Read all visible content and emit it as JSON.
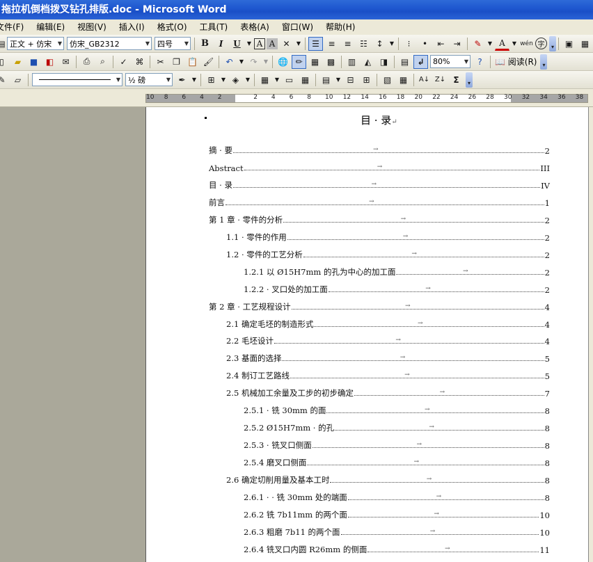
{
  "window": {
    "title": "拖拉机倒档拨叉钻孔排版.doc - Microsoft Word"
  },
  "menu": [
    "文件(F)",
    "编辑(E)",
    "视图(V)",
    "插入(I)",
    "格式(O)",
    "工具(T)",
    "表格(A)",
    "窗口(W)",
    "帮助(H)"
  ],
  "format_toolbar": {
    "style": "正文 + 仿宋",
    "font": "仿宋_GB2312",
    "size": "四号",
    "bold": "B",
    "italic": "I",
    "underline": "U",
    "char_border": "A",
    "char_shading": "A",
    "font_color": "A",
    "phonetic": "wén",
    "enclose": "字"
  },
  "standard_toolbar": {
    "zoom": "80%",
    "read_label": "阅读(R)"
  },
  "drawing_toolbar": {
    "line_weight": "½ 磅",
    "sum": "Σ"
  },
  "ruler": {
    "labels": [
      "10",
      "8",
      "6",
      "4",
      "2",
      "",
      "2",
      "4",
      "6",
      "8",
      "10",
      "12",
      "14",
      "16",
      "18",
      "20",
      "22",
      "24",
      "26",
      "28",
      "30",
      "32",
      "34",
      "36",
      "38"
    ]
  },
  "document": {
    "heading": "目 · 录",
    "toc": [
      {
        "level": 0,
        "title": "摘 · 要",
        "page": "2"
      },
      {
        "level": 0,
        "title": "Abstract",
        "page": "III"
      },
      {
        "level": 0,
        "title": "目 · 录",
        "page": "IV"
      },
      {
        "level": 0,
        "title": "前言",
        "page": "1"
      },
      {
        "level": 0,
        "title": "第 1 章 · 零件的分析",
        "page": "2"
      },
      {
        "level": 1,
        "title": "1.1 · 零件的作用",
        "page": "2"
      },
      {
        "level": 1,
        "title": "1.2 · 零件的工艺分析",
        "page": "2"
      },
      {
        "level": 2,
        "title": "1.2.1 以 Ø15H7mm 的孔为中心的加工面",
        "page": "2"
      },
      {
        "level": 2,
        "title": "1.2.2 · 叉口处的加工面",
        "page": "2"
      },
      {
        "level": 0,
        "title": "第 2 章 · 工艺规程设计",
        "page": "4"
      },
      {
        "level": 1,
        "title": "2.1 确定毛坯的制造形式",
        "page": "4"
      },
      {
        "level": 1,
        "title": "2.2 毛坯设计",
        "page": "4"
      },
      {
        "level": 1,
        "title": "2.3 基面的选择",
        "page": "5"
      },
      {
        "level": 1,
        "title": "2.4 制订工艺路线",
        "page": "5"
      },
      {
        "level": 1,
        "title": "2.5 机械加工余量及工步的初步确定",
        "page": "7"
      },
      {
        "level": 2,
        "title": "2.5.1 · 铣 30mm 的面",
        "page": "8"
      },
      {
        "level": 2,
        "title": "2.5.2 Ø15H7mm · 的孔",
        "page": "8"
      },
      {
        "level": 2,
        "title": "2.5.3 · 铣叉口侧面",
        "page": "8"
      },
      {
        "level": 2,
        "title": "2.5.4 磨叉口侧面",
        "page": "8"
      },
      {
        "level": 1,
        "title": "2.6 确定切削用量及基本工时",
        "page": "8"
      },
      {
        "level": 2,
        "title": "2.6.1 · · 铣 30mm 处的端面",
        "page": "8"
      },
      {
        "level": 2,
        "title": "2.6.2 铣 7b11mm 的两个面",
        "page": "10"
      },
      {
        "level": 2,
        "title": "2.6.3 粗磨 7b11 的两个面",
        "page": "10"
      },
      {
        "level": 2,
        "title": "2.6.4 铣叉口内圆 R26mm 的侧面",
        "page": "11"
      }
    ]
  }
}
